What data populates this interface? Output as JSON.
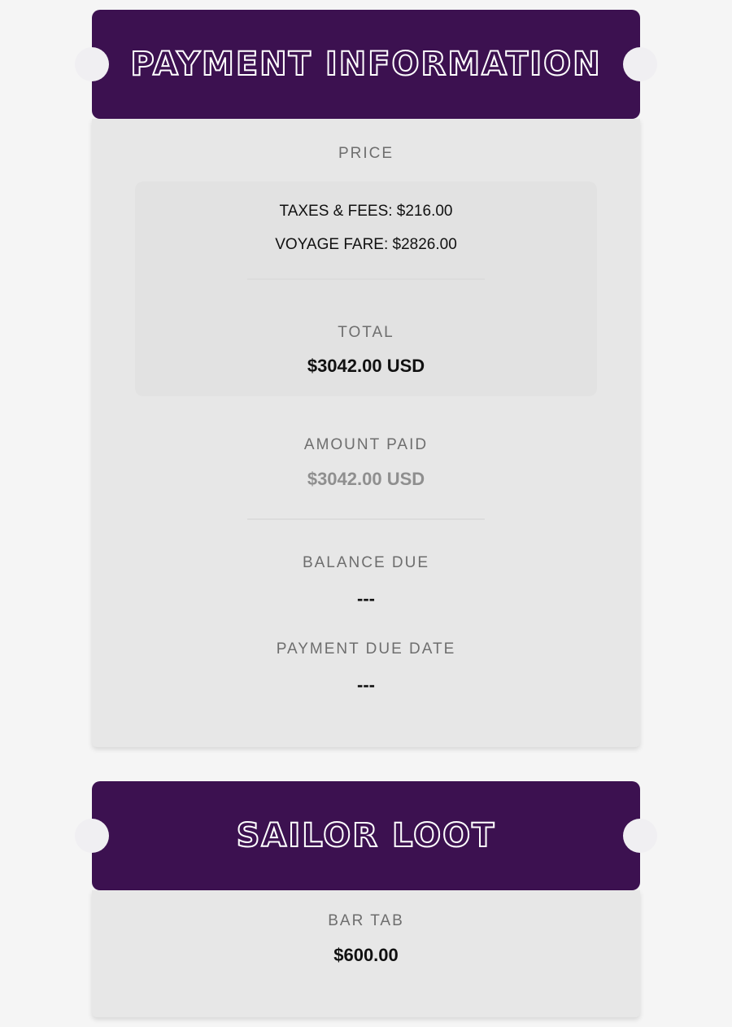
{
  "payment": {
    "title": "Payment Information",
    "price_label": "PRICE",
    "taxes_line": "TAXES & FEES: $216.00",
    "voyage_fare_line": "VOYAGE FARE: $2826.00",
    "total_label": "TOTAL",
    "total_value": "$3042.00 USD",
    "amount_paid_label": "AMOUNT PAID",
    "amount_paid_value": "$3042.00 USD",
    "balance_due_label": "BALANCE DUE",
    "balance_due_value": "---",
    "payment_due_date_label": "PAYMENT DUE DATE",
    "payment_due_date_value": "---"
  },
  "loot": {
    "title": "Sailor Loot",
    "bar_tab_label": "BAR TAB",
    "bar_tab_value": "$600.00"
  },
  "colors": {
    "header_purple": "#3c1150",
    "card_gray": "#e7e7e7",
    "page_background": "#f5f5f5"
  }
}
